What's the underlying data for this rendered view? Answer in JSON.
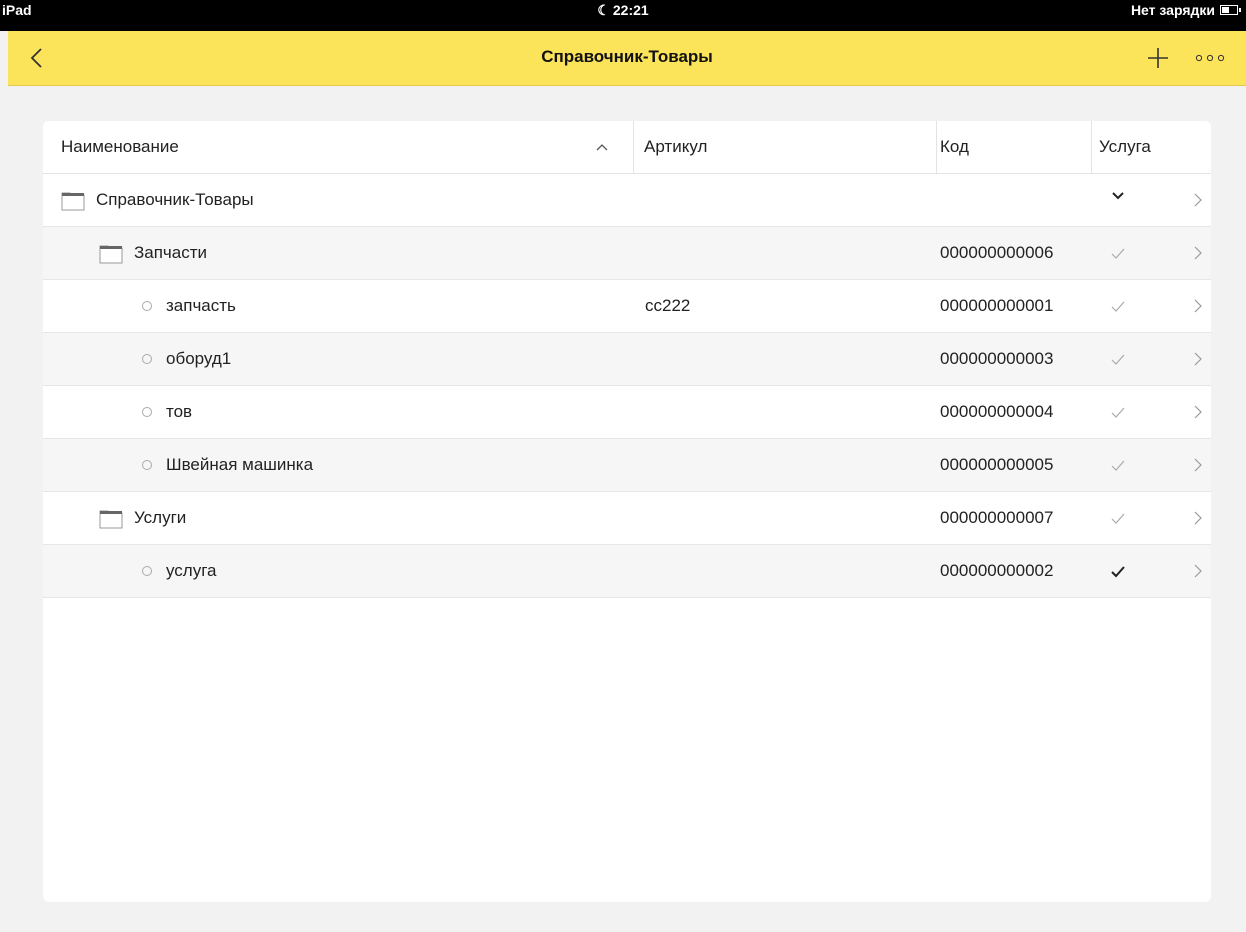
{
  "status_bar": {
    "device": "iPad",
    "time": "22:21",
    "battery_text": "Нет зарядки"
  },
  "nav": {
    "title": "Справочник-Товары",
    "icons": [
      "back-icon",
      "plus-icon",
      "more-icon"
    ]
  },
  "table": {
    "columns": {
      "name": "Наименование",
      "article": "Артикул",
      "code": "Код",
      "service": "Услуга"
    },
    "sort": "ascending",
    "rows": [
      {
        "type": "folder",
        "level": 0,
        "name": "Справочник-Товары",
        "article": "",
        "code": "",
        "service": "expand"
      },
      {
        "type": "folder",
        "level": 1,
        "name": "Запчасти",
        "article": "",
        "code": "000000000006",
        "service": false
      },
      {
        "type": "item",
        "level": 2,
        "name": "запчасть",
        "article": "cc222",
        "code": "000000000001",
        "service": false
      },
      {
        "type": "item",
        "level": 2,
        "name": "оборуд1",
        "article": "",
        "code": "000000000003",
        "service": false
      },
      {
        "type": "item",
        "level": 2,
        "name": "тов",
        "article": "",
        "code": "000000000004",
        "service": false
      },
      {
        "type": "item",
        "level": 2,
        "name": "Швейная машинка",
        "article": "",
        "code": "000000000005",
        "service": false
      },
      {
        "type": "folder",
        "level": 1,
        "name": "Услуги",
        "article": "",
        "code": "000000000007",
        "service": false
      },
      {
        "type": "item",
        "level": 2,
        "name": "услуга",
        "article": "",
        "code": "000000000002",
        "service": true
      }
    ]
  },
  "colors": {
    "nav_background": "#fce45a",
    "status_bar": "#000000",
    "page_background": "#f2f2f2",
    "alt_row": "#f6f6f6",
    "check_muted": "#aaaaaa",
    "check_active": "#222222"
  }
}
